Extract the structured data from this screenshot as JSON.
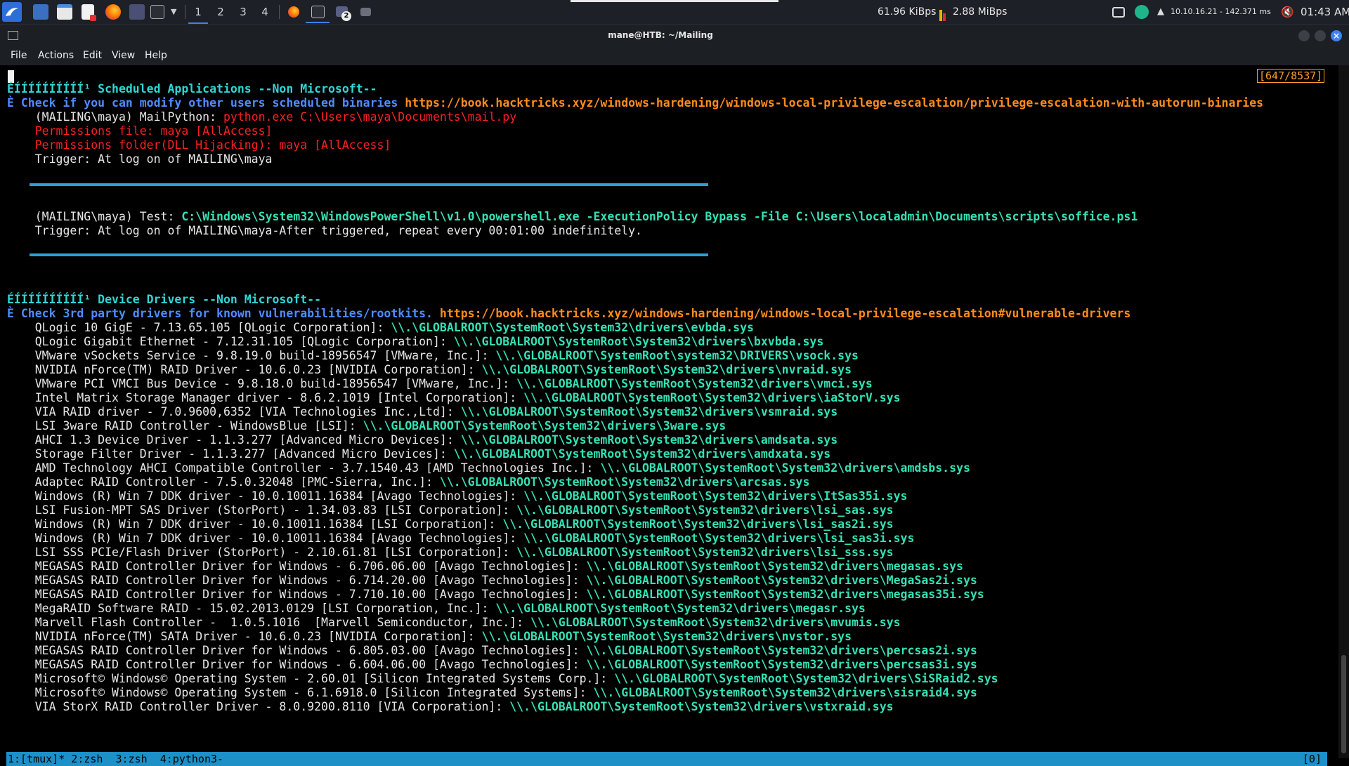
{
  "taskbar": {
    "workspaces": [
      "1",
      "2",
      "3",
      "4"
    ],
    "badge": "2",
    "net_down": "61.96 KiBps",
    "net_up": "2.88 MiBps",
    "vpn": "10.10.16.21 - 142.371 ms",
    "clock": "01:43 AM"
  },
  "window": {
    "title": "mane@HTB: ~/Mailing",
    "menu": [
      "File",
      "Actions",
      "Edit",
      "View",
      "Help"
    ]
  },
  "terminal": {
    "line_counter": "[647/8537]",
    "sched_header_prefix": "ÉÍÍÍÍÍÍÍÍÍÍ¹ ",
    "sched_header": "Scheduled Applications --Non Microsoft--",
    "sched_check_prefix": "È ",
    "sched_check": "Check if you can modify other users scheduled binaries ",
    "sched_link": "https://book.hacktricks.xyz/windows-hardening/windows-local-privilege-escalation/privilege-escalation-with-autorun-binaries",
    "mail_prefix": "    (MAILING\\maya) MailPython: ",
    "mail_path": "python.exe C:\\Users\\maya\\Documents\\mail.py",
    "perm_file": "    Permissions file: maya [AllAccess]",
    "perm_folder": "    Permissions folder(DLL Hijacking): maya [AllAccess]",
    "trigger1": "    Trigger: At log on of MAILING\\maya",
    "test_prefix": "    (MAILING\\maya) Test: ",
    "test_cmd": "C:\\Windows\\System32\\WindowsPowerShell\\v1.0\\powershell.exe -ExecutionPolicy Bypass -File C:\\Users\\localadmin\\Documents\\scripts\\soffice.ps1",
    "trigger2": "    Trigger: At log on of MAILING\\maya-After triggered, repeat every 00:01:00 indefinitely.",
    "drv_header_prefix": "ÉÍÍÍÍÍÍÍÍÍÍ¹ ",
    "drv_header": "Device Drivers --Non Microsoft--",
    "drv_check_prefix": "È ",
    "drv_check": "Check 3rd party drivers for known vulnerabilities/rootkits. ",
    "drv_link": "https://book.hacktricks.xyz/windows-hardening/windows-local-privilege-escalation#vulnerable-drivers",
    "drivers": [
      {
        "desc": "    QLogic 10 GigE - 7.13.65.105 [QLogic Corporation]: ",
        "path": "\\\\.\\GLOBALROOT\\SystemRoot\\System32\\drivers\\evbda.sys"
      },
      {
        "desc": "    QLogic Gigabit Ethernet - 7.12.31.105 [QLogic Corporation]: ",
        "path": "\\\\.\\GLOBALROOT\\SystemRoot\\System32\\drivers\\bxvbda.sys"
      },
      {
        "desc": "    VMware vSockets Service - 9.8.19.0 build-18956547 [VMware, Inc.]: ",
        "path": "\\\\.\\GLOBALROOT\\SystemRoot\\system32\\DRIVERS\\vsock.sys"
      },
      {
        "desc": "    NVIDIA nForce(TM) RAID Driver - 10.6.0.23 [NVIDIA Corporation]: ",
        "path": "\\\\.\\GLOBALROOT\\SystemRoot\\System32\\drivers\\nvraid.sys"
      },
      {
        "desc": "    VMware PCI VMCI Bus Device - 9.8.18.0 build-18956547 [VMware, Inc.]: ",
        "path": "\\\\.\\GLOBALROOT\\SystemRoot\\System32\\drivers\\vmci.sys"
      },
      {
        "desc": "    Intel Matrix Storage Manager driver - 8.6.2.1019 [Intel Corporation]: ",
        "path": "\\\\.\\GLOBALROOT\\SystemRoot\\System32\\drivers\\iaStorV.sys"
      },
      {
        "desc": "    VIA RAID driver - 7.0.9600,6352 [VIA Technologies Inc.,Ltd]: ",
        "path": "\\\\.\\GLOBALROOT\\SystemRoot\\System32\\drivers\\vsmraid.sys"
      },
      {
        "desc": "    LSI 3ware RAID Controller - WindowsBlue [LSI]: ",
        "path": "\\\\.\\GLOBALROOT\\SystemRoot\\System32\\drivers\\3ware.sys"
      },
      {
        "desc": "    AHCI 1.3 Device Driver - 1.1.3.277 [Advanced Micro Devices]: ",
        "path": "\\\\.\\GLOBALROOT\\SystemRoot\\System32\\drivers\\amdsata.sys"
      },
      {
        "desc": "    Storage Filter Driver - 1.1.3.277 [Advanced Micro Devices]: ",
        "path": "\\\\.\\GLOBALROOT\\SystemRoot\\System32\\drivers\\amdxata.sys"
      },
      {
        "desc": "    AMD Technology AHCI Compatible Controller - 3.7.1540.43 [AMD Technologies Inc.]: ",
        "path": "\\\\.\\GLOBALROOT\\SystemRoot\\System32\\drivers\\amdsbs.sys"
      },
      {
        "desc": "    Adaptec RAID Controller - 7.5.0.32048 [PMC-Sierra, Inc.]: ",
        "path": "\\\\.\\GLOBALROOT\\SystemRoot\\System32\\drivers\\arcsas.sys"
      },
      {
        "desc": "    Windows (R) Win 7 DDK driver - 10.0.10011.16384 [Avago Technologies]: ",
        "path": "\\\\.\\GLOBALROOT\\SystemRoot\\System32\\drivers\\ItSas35i.sys"
      },
      {
        "desc": "    LSI Fusion-MPT SAS Driver (StorPort) - 1.34.03.83 [LSI Corporation]: ",
        "path": "\\\\.\\GLOBALROOT\\SystemRoot\\System32\\drivers\\lsi_sas.sys"
      },
      {
        "desc": "    Windows (R) Win 7 DDK driver - 10.0.10011.16384 [LSI Corporation]: ",
        "path": "\\\\.\\GLOBALROOT\\SystemRoot\\System32\\drivers\\lsi_sas2i.sys"
      },
      {
        "desc": "    Windows (R) Win 7 DDK driver - 10.0.10011.16384 [Avago Technologies]: ",
        "path": "\\\\.\\GLOBALROOT\\SystemRoot\\System32\\drivers\\lsi_sas3i.sys"
      },
      {
        "desc": "    LSI SSS PCIe/Flash Driver (StorPort) - 2.10.61.81 [LSI Corporation]: ",
        "path": "\\\\.\\GLOBALROOT\\SystemRoot\\System32\\drivers\\lsi_sss.sys"
      },
      {
        "desc": "    MEGASAS RAID Controller Driver for Windows - 6.706.06.00 [Avago Technologies]: ",
        "path": "\\\\.\\GLOBALROOT\\SystemRoot\\System32\\drivers\\megasas.sys"
      },
      {
        "desc": "    MEGASAS RAID Controller Driver for Windows - 6.714.20.00 [Avago Technologies]: ",
        "path": "\\\\.\\GLOBALROOT\\SystemRoot\\System32\\drivers\\MegaSas2i.sys"
      },
      {
        "desc": "    MEGASAS RAID Controller Driver for Windows - 7.710.10.00 [Avago Technologies]: ",
        "path": "\\\\.\\GLOBALROOT\\SystemRoot\\System32\\drivers\\megasas35i.sys"
      },
      {
        "desc": "    MegaRAID Software RAID - 15.02.2013.0129 [LSI Corporation, Inc.]: ",
        "path": "\\\\.\\GLOBALROOT\\SystemRoot\\System32\\drivers\\megasr.sys"
      },
      {
        "desc": "    Marvell Flash Controller -  1.0.5.1016  [Marvell Semiconductor, Inc.]: ",
        "path": "\\\\.\\GLOBALROOT\\SystemRoot\\System32\\drivers\\mvumis.sys"
      },
      {
        "desc": "    NVIDIA nForce(TM) SATA Driver - 10.6.0.23 [NVIDIA Corporation]: ",
        "path": "\\\\.\\GLOBALROOT\\SystemRoot\\System32\\drivers\\nvstor.sys"
      },
      {
        "desc": "    MEGASAS RAID Controller Driver for Windows - 6.805.03.00 [Avago Technologies]: ",
        "path": "\\\\.\\GLOBALROOT\\SystemRoot\\System32\\drivers\\percsas2i.sys"
      },
      {
        "desc": "    MEGASAS RAID Controller Driver for Windows - 6.604.06.00 [Avago Technologies]: ",
        "path": "\\\\.\\GLOBALROOT\\SystemRoot\\System32\\drivers\\percsas3i.sys"
      },
      {
        "desc": "    Microsoft© Windows© Operating System - 2.60.01 [Silicon Integrated Systems Corp.]: ",
        "path": "\\\\.\\GLOBALROOT\\SystemRoot\\System32\\drivers\\SiSRaid2.sys"
      },
      {
        "desc": "    Microsoft© Windows© Operating System - 6.1.6918.0 [Silicon Integrated Systems]: ",
        "path": "\\\\.\\GLOBALROOT\\SystemRoot\\System32\\drivers\\sisraid4.sys"
      },
      {
        "desc": "    VIA StorX RAID Controller Driver - 8.0.9200.8110 [VIA Corporation]: ",
        "path": "\\\\.\\GLOBALROOT\\SystemRoot\\System32\\drivers\\vstxraid.sys"
      }
    ]
  },
  "tmux": {
    "windows": "1:[tmux]* 2:zsh  3:zsh  4:python3-",
    "right": "[0]"
  }
}
